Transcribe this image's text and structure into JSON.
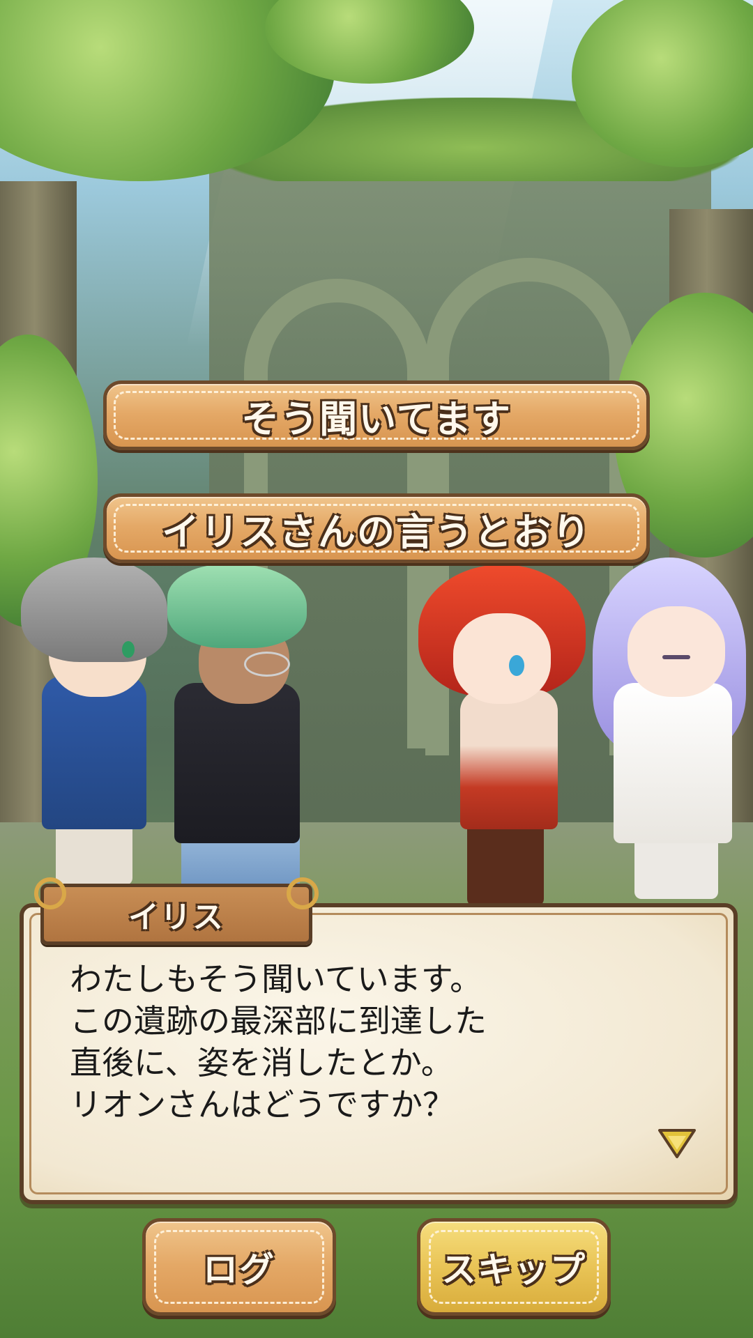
{
  "choices": [
    {
      "label": "そう聞いてます"
    },
    {
      "label": "イリスさんの言うとおり"
    }
  ],
  "dialog": {
    "speaker": "イリス",
    "lines": [
      "わたしもそう聞いています。",
      "この遺跡の最深部に到達した",
      "直後に、姿を消したとか。",
      "リオンさんはどうですか？"
    ],
    "next_icon": "chevron-down-icon"
  },
  "buttons": {
    "log_label": "ログ",
    "skip_label": "スキップ"
  },
  "colors": {
    "button_brown": "#e4a866",
    "button_gold": "#e9c456",
    "outline": "#4a2f1a",
    "dialog_paper": "#f2e8d2",
    "next_icon": "#e2c23a"
  }
}
